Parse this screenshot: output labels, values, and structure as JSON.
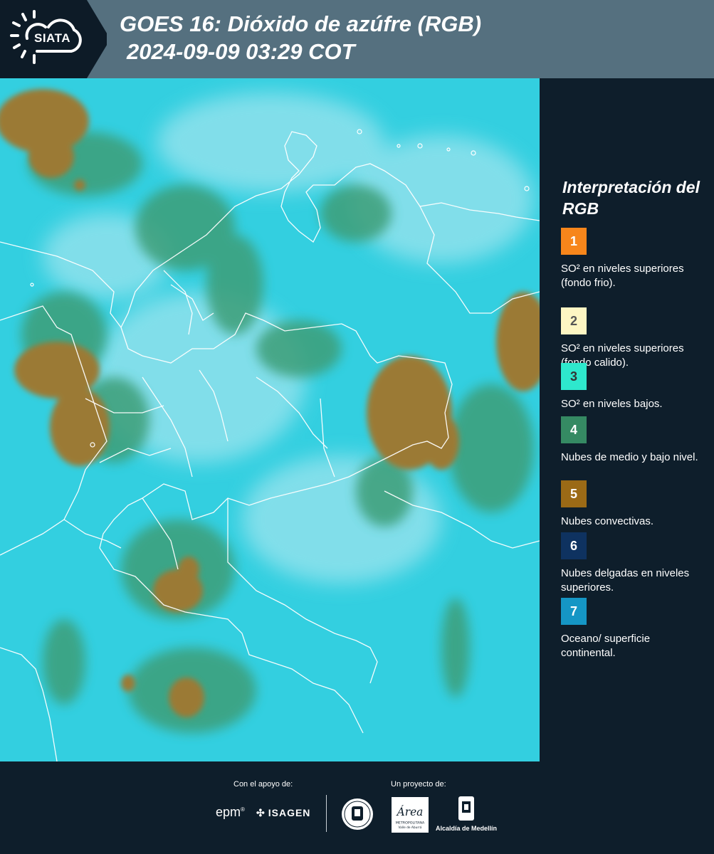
{
  "header": {
    "logo_text": "SIATA",
    "title_line1": "GOES 16: Dióxido de azúfre (RGB)",
    "title_line2": "2024-09-09 03:29 COT"
  },
  "legend": {
    "title": "Interpretación del RGB",
    "items": [
      {
        "number": "1",
        "color": "#f7861b",
        "text_color": "#ffffff",
        "label": "SO² en niveles superiores (fondo frio)."
      },
      {
        "number": "2",
        "color": "#fdf6c3",
        "text_color": "#555555",
        "label": "SO² en niveles superiores (fondo calido)."
      },
      {
        "number": "3",
        "color": "#2ee8cd",
        "text_color": "#333333",
        "label": "SO² en niveles bajos."
      },
      {
        "number": "4",
        "color": "#358a63",
        "text_color": "#ffffff",
        "label": "Nubes de medio y bajo nivel."
      },
      {
        "number": "5",
        "color": "#9b6a16",
        "text_color": "#ffffff",
        "label": "Nubes convectivas."
      },
      {
        "number": "6",
        "color": "#0e3260",
        "text_color": "#ffffff",
        "label": "Nubes delgadas en niveles superiores."
      },
      {
        "number": "7",
        "color": "#1596c5",
        "text_color": "#ffffff",
        "label": "Oceano/ superficie continental."
      }
    ]
  },
  "footer": {
    "support_label": "Con el apoyo de:",
    "project_label": "Un proyecto de:",
    "epm": "epm",
    "isagen": "ISAGEN",
    "alcaldia": "Alcaldía de Medellín"
  },
  "colors": {
    "header_bg": "#55707f",
    "panel_bg": "#0e1e2b",
    "map_cyan": "#2fd2e2",
    "map_green": "#3a9d78",
    "convective_brown": "#9b7a35"
  }
}
